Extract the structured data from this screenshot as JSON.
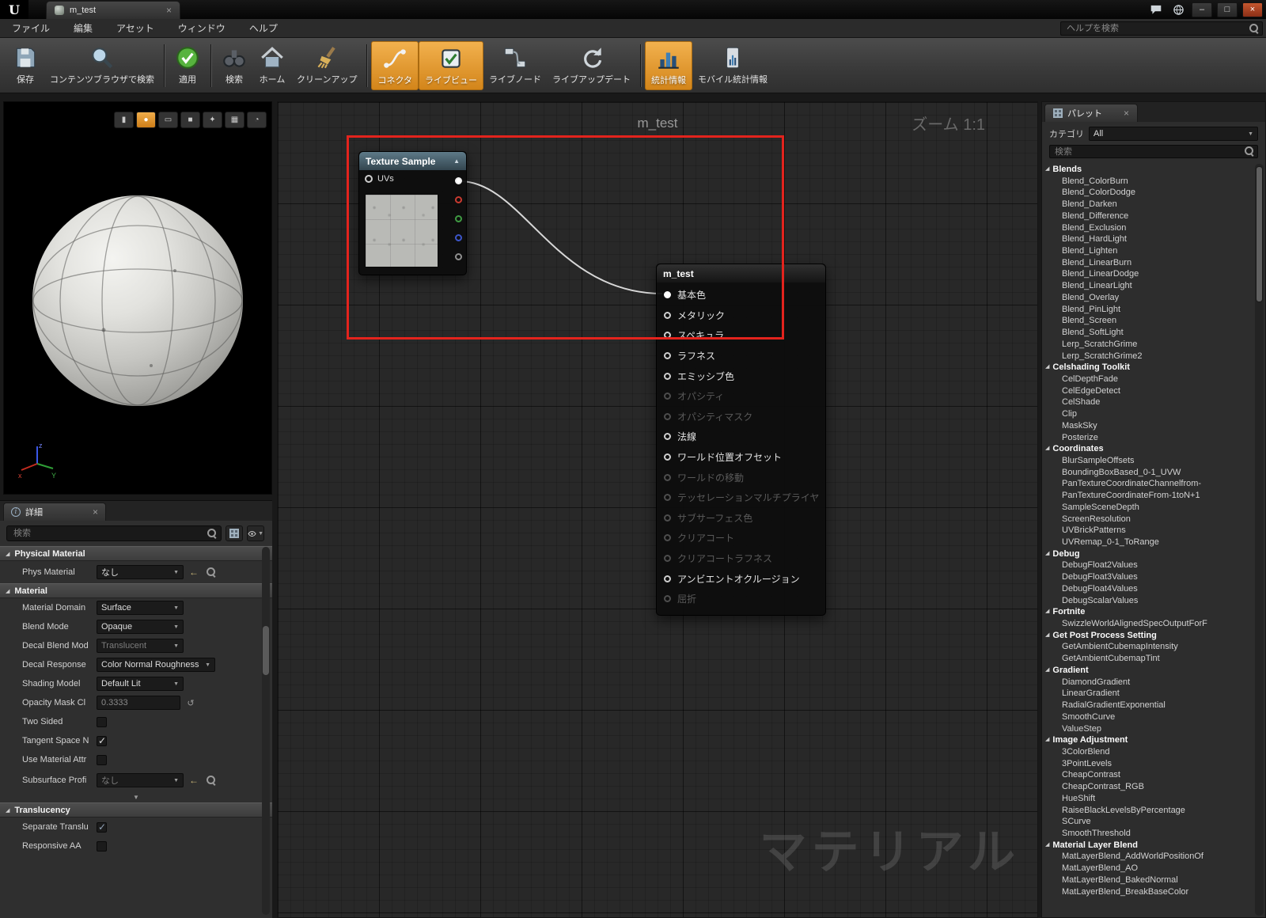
{
  "titlebar": {
    "tab_title": "m_test"
  },
  "menubar": {
    "items": [
      {
        "label": "ファイル"
      },
      {
        "label": "編集"
      },
      {
        "label": "アセット"
      },
      {
        "label": "ウィンドウ"
      },
      {
        "label": "ヘルプ"
      }
    ],
    "help_search_placeholder": "ヘルプを検索"
  },
  "toolbar": {
    "buttons": [
      {
        "label": "保存",
        "icon": "save",
        "active": false
      },
      {
        "label": "コンテンツブラウザで検索",
        "icon": "find-in-content-browser",
        "active": false
      },
      {
        "label": "適用",
        "icon": "apply-check",
        "active": false
      },
      {
        "label": "検索",
        "icon": "search-binoculars",
        "active": false
      },
      {
        "label": "ホーム",
        "icon": "home",
        "active": false
      },
      {
        "label": "クリーンアップ",
        "icon": "clean-up",
        "active": false
      },
      {
        "label": "コネクタ",
        "icon": "connectors",
        "active": true
      },
      {
        "label": "ライブビュー",
        "icon": "live-preview",
        "active": true
      },
      {
        "label": "ライブノード",
        "icon": "live-nodes",
        "active": false
      },
      {
        "label": "ライブアップデート",
        "icon": "live-update",
        "active": false
      },
      {
        "label": "統計情報",
        "icon": "stats",
        "active": true
      },
      {
        "label": "モバイル統計情報",
        "icon": "mobile-stats",
        "active": false
      }
    ]
  },
  "viewport": {
    "buttons": [
      {
        "name": "preview-cylinder",
        "glyph": "▮",
        "active": false
      },
      {
        "name": "preview-sphere",
        "glyph": "●",
        "active": true
      },
      {
        "name": "preview-plane",
        "glyph": "▭",
        "active": false
      },
      {
        "name": "preview-cube",
        "glyph": "■",
        "active": false
      },
      {
        "name": "preview-mesh",
        "glyph": "✦",
        "active": false
      },
      {
        "name": "grid-toggle",
        "glyph": "▦",
        "active": false
      },
      {
        "name": "realtime-toggle",
        "glyph": "◔",
        "active": false
      }
    ],
    "axis": {
      "x": "x",
      "y": "Y",
      "z": "z"
    }
  },
  "details": {
    "tab_label": "詳細",
    "search_placeholder": "検索",
    "physical_material": {
      "title": "Physical Material",
      "phys_material_label": "Phys Material",
      "phys_material_value": "なし"
    },
    "material": {
      "title": "Material",
      "material_domain_label": "Material Domain",
      "material_domain_value": "Surface",
      "blend_mode_label": "Blend Mode",
      "blend_mode_value": "Opaque",
      "decal_blend_mode_label": "Decal Blend Mod",
      "decal_blend_mode_value": "Translucent",
      "decal_blend_mode_disabled": true,
      "decal_response_label": "Decal Response",
      "decal_response_value": "Color Normal Roughness",
      "shading_model_label": "Shading Model",
      "shading_model_value": "Default Lit",
      "opacity_mask_label": "Opacity Mask Cl",
      "opacity_mask_value": "0.3333",
      "opacity_mask_disabled": true,
      "two_sided_label": "Two Sided",
      "two_sided_checked": false,
      "tangent_space_label": "Tangent Space N",
      "tangent_space_checked": true,
      "use_material_attr_label": "Use Material Attr",
      "use_material_attr_checked": false,
      "subsurface_profile_label": "Subsurface Profi",
      "subsurface_profile_value": "なし",
      "subsurface_profile_disabled": true
    },
    "translucency": {
      "title": "Translucency",
      "separate_label": "Separate Translu",
      "separate_checked": true,
      "separate_disabled": true,
      "responsive_label": "Responsive AA",
      "responsive_checked": false,
      "responsive_disabled": true
    }
  },
  "graph": {
    "title": "m_test",
    "zoom_label": "ズーム 1:1",
    "watermark": "マテリアル",
    "annotation_color": "#e3231d",
    "wire_color": "#d8d8d8",
    "texture_sample": {
      "title": "Texture Sample",
      "uv_label": "UVs",
      "outputs": [
        {
          "name": "rgb",
          "color": "#f2f2f2",
          "filled": true
        },
        {
          "name": "r",
          "color": "#c93a30",
          "filled": false
        },
        {
          "name": "g",
          "color": "#3f9b43",
          "filled": false
        },
        {
          "name": "b",
          "color": "#3c55c8",
          "filled": false
        },
        {
          "name": "a",
          "color": "#8f8f8f",
          "filled": false
        }
      ]
    },
    "result_node": {
      "title": "m_test",
      "pins": [
        {
          "label": "基本色",
          "connected": true,
          "disabled": false
        },
        {
          "label": "メタリック",
          "connected": false,
          "disabled": false
        },
        {
          "label": "スペキュラ",
          "connected": false,
          "disabled": false
        },
        {
          "label": "ラフネス",
          "connected": false,
          "disabled": false
        },
        {
          "label": "エミッシブ色",
          "connected": false,
          "disabled": false
        },
        {
          "label": "オパシティ",
          "connected": false,
          "disabled": true
        },
        {
          "label": "オパシティマスク",
          "connected": false,
          "disabled": true
        },
        {
          "label": "法線",
          "connected": false,
          "disabled": false
        },
        {
          "label": "ワールド位置オフセット",
          "connected": false,
          "disabled": false
        },
        {
          "label": "ワールドの移動",
          "connected": false,
          "disabled": true
        },
        {
          "label": "テッセレーションマルチプライヤ",
          "connected": false,
          "disabled": true
        },
        {
          "label": "サブサーフェス色",
          "connected": false,
          "disabled": true
        },
        {
          "label": "クリアコート",
          "connected": false,
          "disabled": true
        },
        {
          "label": "クリアコートラフネス",
          "connected": false,
          "disabled": true
        },
        {
          "label": "アンビエントオクルージョン",
          "connected": false,
          "disabled": false
        },
        {
          "label": "屈折",
          "connected": false,
          "disabled": true
        }
      ]
    }
  },
  "palette": {
    "tab_label": "パレット",
    "category_label": "カテゴリ",
    "category_value": "All",
    "search_placeholder": "検索",
    "rows": [
      {
        "label": "Blends",
        "cat": true
      },
      {
        "label": "Blend_ColorBurn"
      },
      {
        "label": "Blend_ColorDodge"
      },
      {
        "label": "Blend_Darken"
      },
      {
        "label": "Blend_Difference"
      },
      {
        "label": "Blend_Exclusion"
      },
      {
        "label": "Blend_HardLight"
      },
      {
        "label": "Blend_Lighten"
      },
      {
        "label": "Blend_LinearBurn"
      },
      {
        "label": "Blend_LinearDodge"
      },
      {
        "label": "Blend_LinearLight"
      },
      {
        "label": "Blend_Overlay"
      },
      {
        "label": "Blend_PinLight"
      },
      {
        "label": "Blend_Screen"
      },
      {
        "label": "Blend_SoftLight"
      },
      {
        "label": "Lerp_ScratchGrime"
      },
      {
        "label": "Lerp_ScratchGrime2"
      },
      {
        "label": "Celshading Toolkit",
        "cat": true
      },
      {
        "label": "CelDepthFade"
      },
      {
        "label": "CelEdgeDetect"
      },
      {
        "label": "CelShade"
      },
      {
        "label": "Clip"
      },
      {
        "label": "MaskSky"
      },
      {
        "label": "Posterize"
      },
      {
        "label": "Coordinates",
        "cat": true
      },
      {
        "label": "BlurSampleOffsets"
      },
      {
        "label": "BoundingBoxBased_0-1_UVW"
      },
      {
        "label": "PanTextureCoordinateChannelfrom-"
      },
      {
        "label": "PanTextureCoordinateFrom-1toN+1"
      },
      {
        "label": "SampleSceneDepth"
      },
      {
        "label": "ScreenResolution"
      },
      {
        "label": "UVBrickPatterns"
      },
      {
        "label": "UVRemap_0-1_ToRange"
      },
      {
        "label": "Debug",
        "cat": true
      },
      {
        "label": "DebugFloat2Values"
      },
      {
        "label": "DebugFloat3Values"
      },
      {
        "label": "DebugFloat4Values"
      },
      {
        "label": "DebugScalarValues"
      },
      {
        "label": "Fortnite",
        "cat": true
      },
      {
        "label": "SwizzleWorldAlignedSpecOutputForF"
      },
      {
        "label": "Get Post Process Setting",
        "cat": true
      },
      {
        "label": "GetAmbientCubemapIntensity"
      },
      {
        "label": "GetAmbientCubemapTint"
      },
      {
        "label": "Gradient",
        "cat": true
      },
      {
        "label": "DiamondGradient"
      },
      {
        "label": "LinearGradient"
      },
      {
        "label": "RadialGradientExponential"
      },
      {
        "label": "SmoothCurve"
      },
      {
        "label": "ValueStep"
      },
      {
        "label": "Image Adjustment",
        "cat": true
      },
      {
        "label": "3ColorBlend"
      },
      {
        "label": "3PointLevels"
      },
      {
        "label": "CheapContrast"
      },
      {
        "label": "CheapContrast_RGB"
      },
      {
        "label": "HueShift"
      },
      {
        "label": "RaiseBlackLevelsByPercentage"
      },
      {
        "label": "SCurve"
      },
      {
        "label": "SmoothThreshold"
      },
      {
        "label": "Material Layer Blend",
        "cat": true
      },
      {
        "label": "MatLayerBlend_AddWorldPositionOf"
      },
      {
        "label": "MatLayerBlend_AO"
      },
      {
        "label": "MatLayerBlend_BakedNormal"
      },
      {
        "label": "MatLayerBlend_BreakBaseColor"
      }
    ]
  },
  "colors": {
    "accent_orange": "#d3851a",
    "annotation_red": "#e3231d"
  }
}
